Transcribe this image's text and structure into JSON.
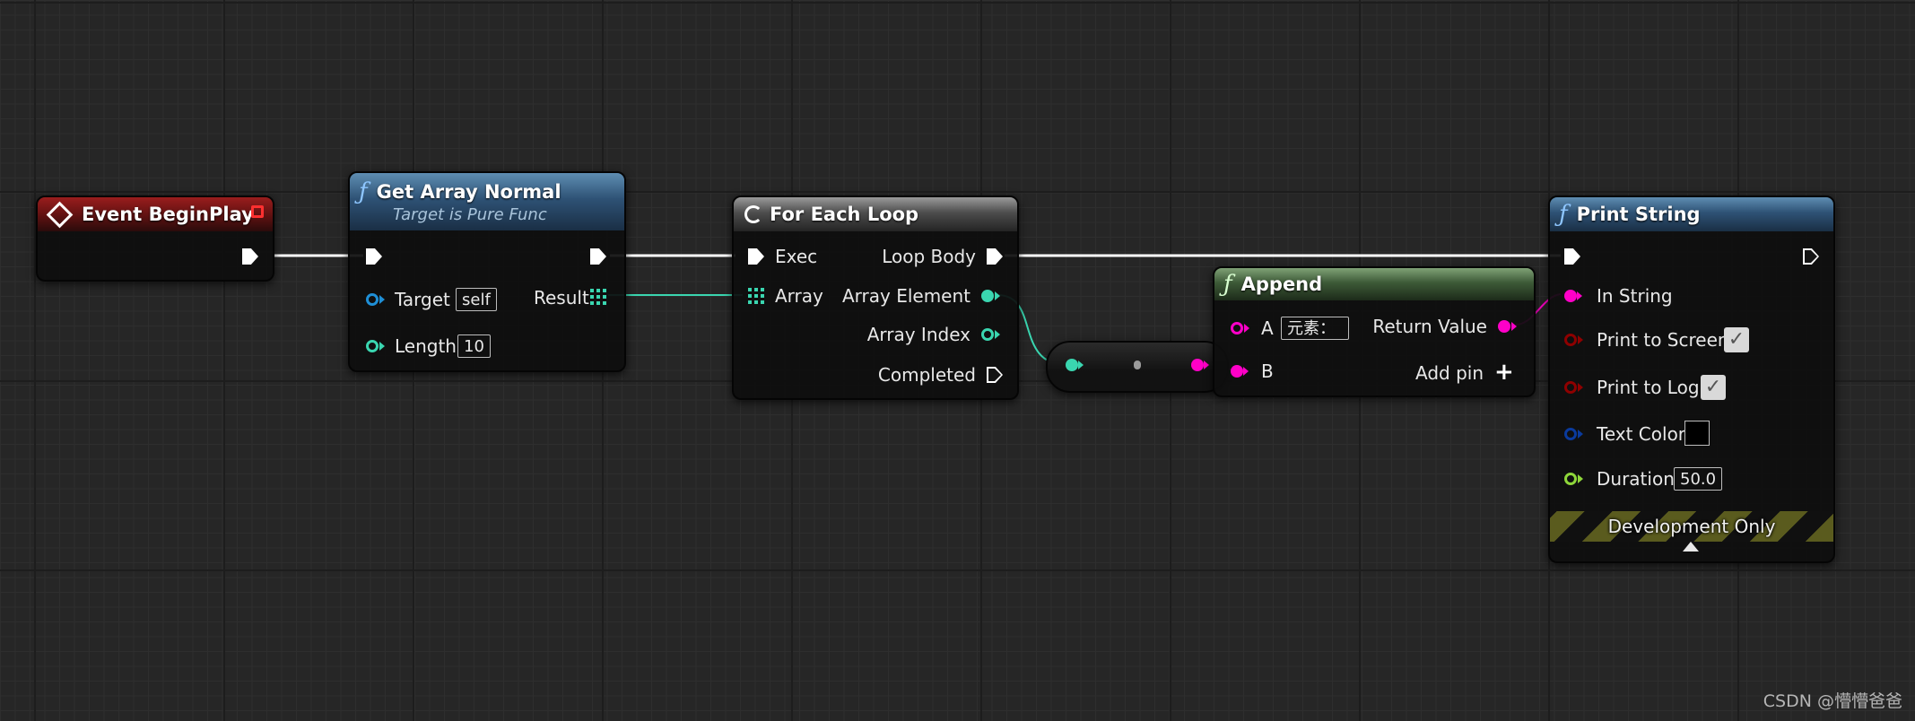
{
  "nodes": {
    "event_begin_play": {
      "title": "Event BeginPlay"
    },
    "get_array_normal": {
      "title": "Get Array Normal",
      "subtitle": "Target is Pure Func",
      "target_label": "Target",
      "target_value": "self",
      "length_label": "Length",
      "length_value": "10",
      "result_label": "Result"
    },
    "for_each_loop": {
      "title": "For Each Loop",
      "exec_label": "Exec",
      "array_label": "Array",
      "loop_body_label": "Loop Body",
      "array_element_label": "Array Element",
      "array_index_label": "Array Index",
      "completed_label": "Completed"
    },
    "append": {
      "title": "Append",
      "a_label": "A",
      "a_value": "元素：",
      "b_label": "B",
      "return_label": "Return Value",
      "add_pin_label": "Add pin"
    },
    "print_string": {
      "title": "Print String",
      "in_string_label": "In String",
      "print_to_screen_label": "Print to Screen",
      "print_to_screen_checked": true,
      "print_to_log_label": "Print to Log",
      "print_to_log_checked": true,
      "text_color_label": "Text Color",
      "text_color_value": "#000000",
      "duration_label": "Duration",
      "duration_value": "50.0",
      "development_only_label": "Development Only"
    }
  },
  "watermark": "CSDN @懵懵爸爸",
  "colors": {
    "exec_wire": "#ffffff",
    "int_pin": "#3ad6b0",
    "string_pin": "#ff00c8",
    "object_pin": "#1f8fd6",
    "bool_pin": "#8e0000",
    "struct_pin": "#0a3a9c",
    "float_pin": "#8ed63a",
    "event_header": "#9a1d1d",
    "function_header": "#2e5275",
    "macro_header": "#4d4d4d",
    "pure_header": "#3d5a37"
  }
}
